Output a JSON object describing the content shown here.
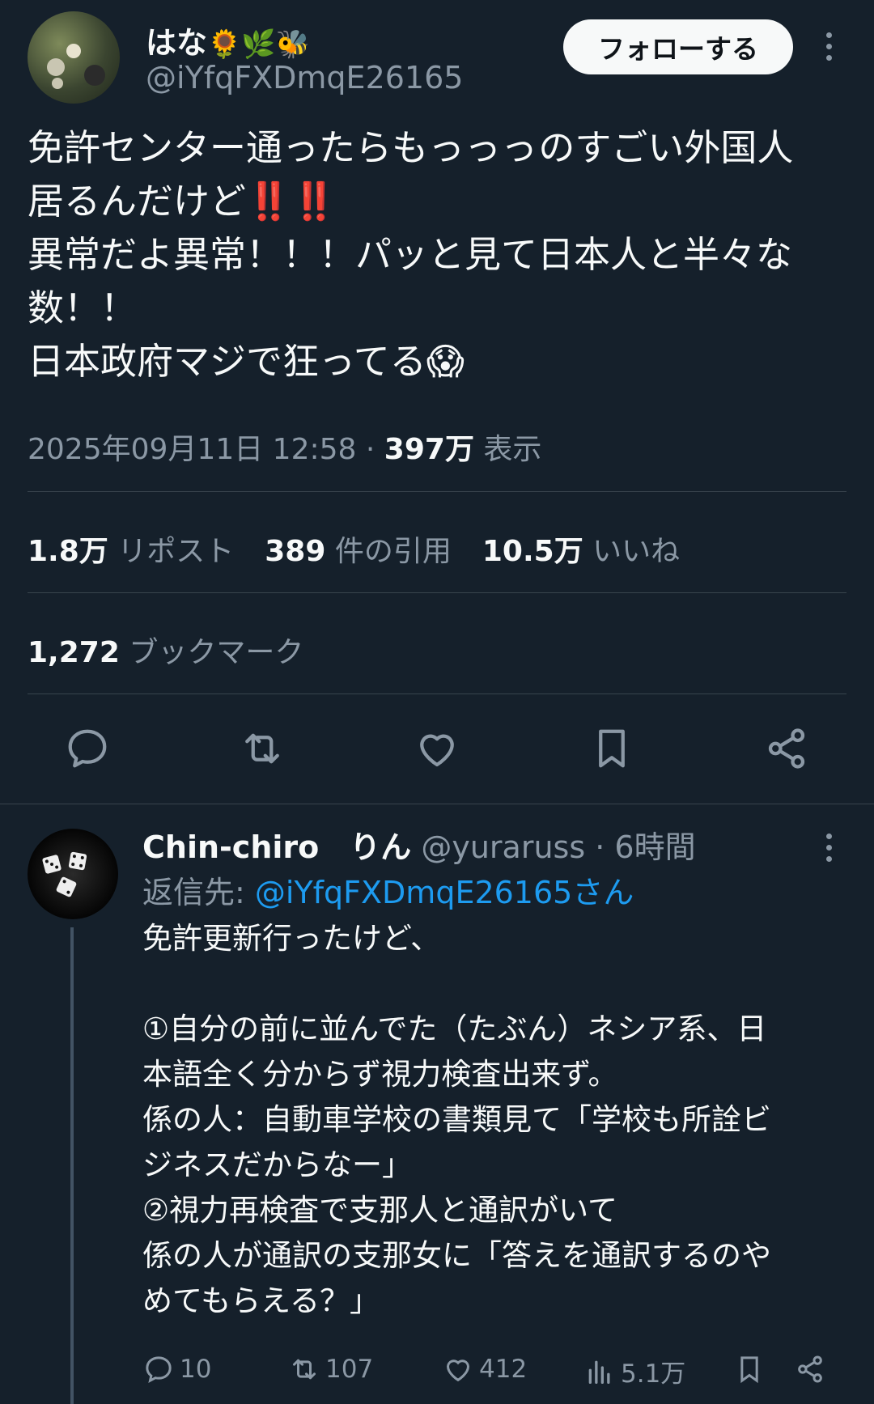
{
  "post": {
    "display_name": "はな",
    "name_emojis": "🌻🌿🐝",
    "handle": "@iYfqFXDmqE26165",
    "follow_label": "フォローする",
    "text": "免許センター通ったらもっっっのすごい外国人\n居るんだけど‼️‼️\n異常だよ異常！！！パッと見て日本人と半々な\n数！！\n日本政府マジで狂ってる😱",
    "timestamp": "2025年09月11日 12:58",
    "dot": "·",
    "views_count": "397万",
    "views_label": "表示",
    "reposts_count": "1.8万",
    "reposts_label": "リポスト",
    "quotes_count": "389",
    "quotes_label": "件の引用",
    "likes_count": "10.5万",
    "likes_label": "いいね",
    "bookmarks_count": "1,272",
    "bookmarks_label": "ブックマーク"
  },
  "reply": {
    "display_name": "Chin-chiro　りん",
    "handle": "@yuraruss",
    "time": "· 6時間",
    "reply_to_prefix": "返信先: ",
    "reply_to_handle": "@iYfqFXDmqE26165さん",
    "text": "免許更新行ったけど、\n\n①自分の前に並んでた（たぶん）ネシア系、日\n本語全く分からず視力検査出来ず。\n係の人：自動車学校の書類見て「学校も所詮ビ\nジネスだからなー」\n②視力再検査で支那人と通訳がいて\n係の人が通訳の支那女に「答えを通訳するのや\nめてもらえる？」",
    "replies": "10",
    "reposts": "107",
    "likes": "412",
    "views": "5.1万"
  },
  "icons": {
    "reply": "speech-bubble-icon",
    "repost": "repost-arrows-icon",
    "like": "heart-icon",
    "bookmark": "bookmark-icon",
    "share": "share-icon",
    "views": "bar-chart-icon",
    "more": "more-dots-icon"
  },
  "colors": {
    "background": "#15202b",
    "text": "#f7f9f9",
    "secondary": "#8b98a5",
    "accent": "#1d9bf0",
    "divider": "#38444d"
  }
}
